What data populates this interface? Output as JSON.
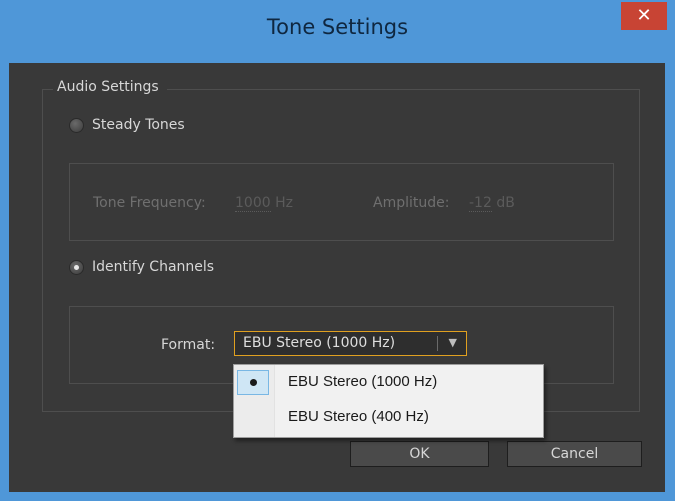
{
  "window": {
    "title": "Tone Settings",
    "close_glyph": "✕"
  },
  "group": {
    "label": "Audio Settings"
  },
  "steady": {
    "label": "Steady Tones",
    "selected": false,
    "frequency_label": "Tone Frequency:",
    "frequency_value": "1000",
    "frequency_unit": "Hz",
    "amplitude_label": "Amplitude:",
    "amplitude_value": "-12",
    "amplitude_unit": "dB"
  },
  "identify": {
    "label": "Identify Channels",
    "selected": true,
    "format_label": "Format:",
    "format_value": "EBU Stereo (1000 Hz)",
    "dropdown_arrow": "▼"
  },
  "dropdown": {
    "options": [
      {
        "label": "EBU Stereo (1000 Hz)",
        "checked": true
      },
      {
        "label": "EBU Stereo (400 Hz)",
        "checked": false
      }
    ]
  },
  "buttons": {
    "ok": "OK",
    "cancel": "Cancel"
  },
  "colors": {
    "title_bar": "#4f97d8",
    "close_button": "#c84434",
    "panel_bg": "#393939",
    "focus_border": "#e0a020",
    "menu_highlight": "#cfe6f5"
  }
}
